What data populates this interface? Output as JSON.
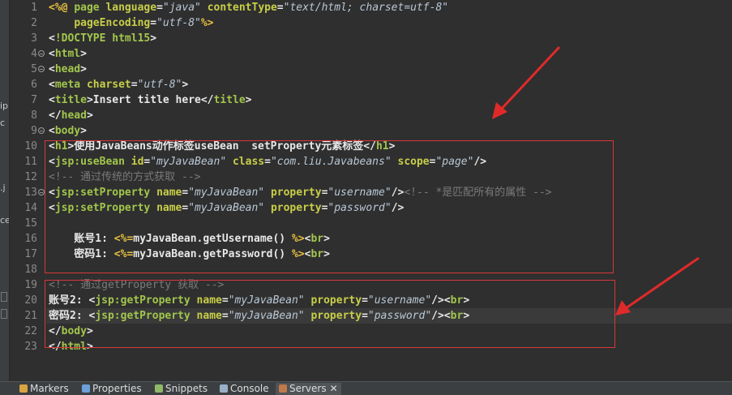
{
  "left_strip_fragments": [
    "ip",
    "c",
    ".j",
    "ce"
  ],
  "lines": [
    {
      "n": "1",
      "fold": false,
      "segs": [
        {
          "c": "t-dl",
          "t": "<%@"
        },
        {
          "c": "t-txt",
          "t": " "
        },
        {
          "c": "t-kw",
          "t": "page"
        },
        {
          "c": "t-txt",
          "t": " "
        },
        {
          "c": "t-at",
          "t": "language"
        },
        {
          "c": "t-txt",
          "t": "="
        },
        {
          "c": "t-str",
          "t": "\"java\""
        },
        {
          "c": "t-txt",
          "t": " "
        },
        {
          "c": "t-at",
          "t": "contentType"
        },
        {
          "c": "t-txt",
          "t": "="
        },
        {
          "c": "t-str",
          "t": "\"text/html; charset=utf-8\""
        }
      ]
    },
    {
      "n": "2",
      "fold": false,
      "segs": [
        {
          "c": "t-txt",
          "t": "    "
        },
        {
          "c": "t-at",
          "t": "pageEncoding"
        },
        {
          "c": "t-txt",
          "t": "="
        },
        {
          "c": "t-str",
          "t": "\"utf-8\""
        },
        {
          "c": "t-dl",
          "t": "%>"
        }
      ]
    },
    {
      "n": "3",
      "fold": false,
      "segs": [
        {
          "c": "t-ang",
          "t": "<"
        },
        {
          "c": "t-kw",
          "t": "!DOCTYPE html15"
        },
        {
          "c": "t-ang",
          "t": ">"
        }
      ]
    },
    {
      "n": "4",
      "fold": true,
      "segs": [
        {
          "c": "t-ang",
          "t": "<"
        },
        {
          "c": "t-kw",
          "t": "html"
        },
        {
          "c": "t-ang",
          "t": ">"
        }
      ]
    },
    {
      "n": "5",
      "fold": true,
      "segs": [
        {
          "c": "t-ang",
          "t": "<"
        },
        {
          "c": "t-kw",
          "t": "head"
        },
        {
          "c": "t-ang",
          "t": ">"
        }
      ]
    },
    {
      "n": "6",
      "fold": false,
      "segs": [
        {
          "c": "t-ang",
          "t": "<"
        },
        {
          "c": "t-kw",
          "t": "meta"
        },
        {
          "c": "t-txt",
          "t": " "
        },
        {
          "c": "t-at",
          "t": "charset"
        },
        {
          "c": "t-txt",
          "t": "="
        },
        {
          "c": "t-str",
          "t": "\"utf-8\""
        },
        {
          "c": "t-ang",
          "t": ">"
        }
      ]
    },
    {
      "n": "7",
      "fold": false,
      "segs": [
        {
          "c": "t-ang",
          "t": "<"
        },
        {
          "c": "t-kw",
          "t": "title"
        },
        {
          "c": "t-ang",
          "t": ">"
        },
        {
          "c": "t-txt",
          "t": "Insert title here"
        },
        {
          "c": "t-ang",
          "t": "</"
        },
        {
          "c": "t-kw",
          "t": "title"
        },
        {
          "c": "t-ang",
          "t": ">"
        }
      ]
    },
    {
      "n": "8",
      "fold": false,
      "segs": [
        {
          "c": "t-ang",
          "t": "</"
        },
        {
          "c": "t-kw",
          "t": "head"
        },
        {
          "c": "t-ang",
          "t": ">"
        }
      ]
    },
    {
      "n": "9",
      "fold": true,
      "segs": [
        {
          "c": "t-ang",
          "t": "<"
        },
        {
          "c": "t-kw",
          "t": "body"
        },
        {
          "c": "t-ang",
          "t": ">"
        }
      ]
    },
    {
      "n": "10",
      "fold": false,
      "segs": [
        {
          "c": "t-ang",
          "t": "<"
        },
        {
          "c": "t-kw",
          "t": "h1"
        },
        {
          "c": "t-ang",
          "t": ">"
        },
        {
          "c": "t-txt",
          "t": "使用JavaBeans动作标签useBean  setProperty元素标签"
        },
        {
          "c": "t-ang",
          "t": "</"
        },
        {
          "c": "t-kw",
          "t": "h1"
        },
        {
          "c": "t-ang",
          "t": ">"
        }
      ]
    },
    {
      "n": "11",
      "fold": false,
      "segs": [
        {
          "c": "t-ang",
          "t": "<"
        },
        {
          "c": "t-kw",
          "t": "jsp:useBean"
        },
        {
          "c": "t-txt",
          "t": " "
        },
        {
          "c": "t-at",
          "t": "id"
        },
        {
          "c": "t-txt",
          "t": "="
        },
        {
          "c": "t-str",
          "t": "\"myJavaBean\""
        },
        {
          "c": "t-txt",
          "t": " "
        },
        {
          "c": "t-at",
          "t": "class"
        },
        {
          "c": "t-txt",
          "t": "="
        },
        {
          "c": "t-str",
          "t": "\"com.liu.Javabeans\""
        },
        {
          "c": "t-txt",
          "t": " "
        },
        {
          "c": "t-at",
          "t": "scope"
        },
        {
          "c": "t-txt",
          "t": "="
        },
        {
          "c": "t-str",
          "t": "\"page\""
        },
        {
          "c": "t-ang",
          "t": "/>"
        }
      ]
    },
    {
      "n": "12",
      "fold": false,
      "segs": [
        {
          "c": "t-cm",
          "t": "<!-- 通过传统的方式获取 -->"
        }
      ]
    },
    {
      "n": "13",
      "fold": true,
      "segs": [
        {
          "c": "t-ang",
          "t": "<"
        },
        {
          "c": "t-kw",
          "t": "jsp:setProperty"
        },
        {
          "c": "t-txt",
          "t": " "
        },
        {
          "c": "t-at",
          "t": "name"
        },
        {
          "c": "t-txt",
          "t": "="
        },
        {
          "c": "t-str",
          "t": "\"myJavaBean\""
        },
        {
          "c": "t-txt",
          "t": " "
        },
        {
          "c": "t-at",
          "t": "property"
        },
        {
          "c": "t-txt",
          "t": "="
        },
        {
          "c": "t-str",
          "t": "\"username\""
        },
        {
          "c": "t-ang",
          "t": "/>"
        },
        {
          "c": "t-cm",
          "t": "<!-- *是匹配所有的属性 -->"
        }
      ]
    },
    {
      "n": "14",
      "fold": false,
      "segs": [
        {
          "c": "t-ang",
          "t": "<"
        },
        {
          "c": "t-kw",
          "t": "jsp:setProperty"
        },
        {
          "c": "t-txt",
          "t": " "
        },
        {
          "c": "t-at",
          "t": "name"
        },
        {
          "c": "t-txt",
          "t": "="
        },
        {
          "c": "t-str",
          "t": "\"myJavaBean\""
        },
        {
          "c": "t-txt",
          "t": " "
        },
        {
          "c": "t-at",
          "t": "property"
        },
        {
          "c": "t-txt",
          "t": "="
        },
        {
          "c": "t-str",
          "t": "\"password\""
        },
        {
          "c": "t-ang",
          "t": "/>"
        }
      ]
    },
    {
      "n": "15",
      "fold": false,
      "segs": []
    },
    {
      "n": "16",
      "fold": false,
      "segs": [
        {
          "c": "t-txt",
          "t": "    账号1: "
        },
        {
          "c": "t-dl",
          "t": "<%="
        },
        {
          "c": "t-txt",
          "t": "myJavaBean.getUsername() "
        },
        {
          "c": "t-dl",
          "t": "%>"
        },
        {
          "c": "t-ang",
          "t": "<"
        },
        {
          "c": "t-kw",
          "t": "br"
        },
        {
          "c": "t-ang",
          "t": ">"
        }
      ]
    },
    {
      "n": "17",
      "fold": false,
      "segs": [
        {
          "c": "t-txt",
          "t": "    密码1: "
        },
        {
          "c": "t-dl",
          "t": "<%="
        },
        {
          "c": "t-txt",
          "t": "myJavaBean.getPassword() "
        },
        {
          "c": "t-dl",
          "t": "%>"
        },
        {
          "c": "t-ang",
          "t": "<"
        },
        {
          "c": "t-kw",
          "t": "br"
        },
        {
          "c": "t-ang",
          "t": ">"
        }
      ]
    },
    {
      "n": "18",
      "fold": false,
      "segs": []
    },
    {
      "n": "19",
      "fold": false,
      "segs": [
        {
          "c": "t-cm",
          "t": "<!-- 通过getProperty 获取 -->"
        }
      ]
    },
    {
      "n": "20",
      "fold": false,
      "segs": [
        {
          "c": "t-txt",
          "t": "账号2: "
        },
        {
          "c": "t-ang",
          "t": "<"
        },
        {
          "c": "t-kw",
          "t": "jsp:getProperty"
        },
        {
          "c": "t-txt",
          "t": " "
        },
        {
          "c": "t-at",
          "t": "name"
        },
        {
          "c": "t-txt",
          "t": "="
        },
        {
          "c": "t-str",
          "t": "\"myJavaBean\""
        },
        {
          "c": "t-txt",
          "t": " "
        },
        {
          "c": "t-at",
          "t": "property"
        },
        {
          "c": "t-txt",
          "t": "="
        },
        {
          "c": "t-str",
          "t": "\"username\""
        },
        {
          "c": "t-ang",
          "t": "/><"
        },
        {
          "c": "t-kw",
          "t": "br"
        },
        {
          "c": "t-ang",
          "t": ">"
        }
      ]
    },
    {
      "n": "21",
      "fold": false,
      "current": true,
      "segs": [
        {
          "c": "t-txt",
          "t": "密码2: "
        },
        {
          "c": "t-ang",
          "t": "<"
        },
        {
          "c": "t-kw",
          "t": "jsp:getProperty"
        },
        {
          "c": "t-txt",
          "t": " "
        },
        {
          "c": "t-at",
          "t": "name"
        },
        {
          "c": "t-txt",
          "t": "="
        },
        {
          "c": "t-str",
          "t": "\"myJavaBean\""
        },
        {
          "c": "t-txt",
          "t": " "
        },
        {
          "c": "t-at",
          "t": "property"
        },
        {
          "c": "t-txt",
          "t": "="
        },
        {
          "c": "t-str",
          "t": "\"password\""
        },
        {
          "c": "t-ang",
          "t": "/><"
        },
        {
          "c": "t-kw",
          "t": "br"
        },
        {
          "c": "t-ang",
          "t": ">"
        }
      ]
    },
    {
      "n": "22",
      "fold": false,
      "segs": [
        {
          "c": "t-ang",
          "t": "</"
        },
        {
          "c": "t-kw",
          "t": "body"
        },
        {
          "c": "t-ang",
          "t": ">"
        }
      ]
    },
    {
      "n": "23",
      "fold": false,
      "segs": [
        {
          "c": "t-ang",
          "t": "</"
        },
        {
          "c": "t-kw",
          "t": "html"
        },
        {
          "c": "t-ang",
          "t": ">"
        }
      ]
    }
  ],
  "bottom_tabs": [
    {
      "label": "Markers",
      "icon": "markers-icon",
      "color": "#d9a441"
    },
    {
      "label": "Properties",
      "icon": "properties-icon",
      "color": "#6f9fd8"
    },
    {
      "label": "Snippets",
      "icon": "snippets-icon",
      "color": "#8fb86a"
    },
    {
      "label": "Console",
      "icon": "console-icon",
      "color": "#9ab0c8"
    },
    {
      "label": "Servers",
      "icon": "servers-icon",
      "color": "#c07a4a",
      "active": true
    }
  ],
  "close_glyph": "✕",
  "colors": {
    "annotation": "#e02a2a",
    "editor_bg": "#2f2f2f"
  }
}
